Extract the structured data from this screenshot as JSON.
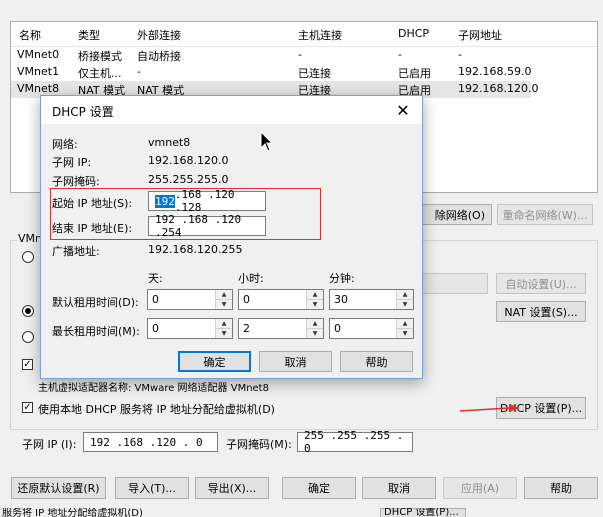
{
  "network_table": {
    "headers": [
      "名称",
      "类型",
      "外部连接",
      "主机连接",
      "DHCP",
      "子网地址"
    ],
    "rows": [
      [
        "VMnet0",
        "桥接模式",
        "自动桥接",
        "-",
        "-",
        "-"
      ],
      [
        "VMnet1",
        "仅主机...",
        "-",
        "已连接",
        "已启用",
        "192.168.59.0"
      ],
      [
        "VMnet8",
        "NAT 模式",
        "NAT 模式",
        "已连接",
        "已启用",
        "192.168.120.0"
      ]
    ]
  },
  "bg": {
    "remove_network": "除网络(O)",
    "rename_network": "重命名网络(W)...",
    "vmnet_group_fragment": "VMne",
    "auto_settings": "自动设置(U)...",
    "nat_settings": "NAT 设置(S)...",
    "host_adapter_name": "主机虚拟适配器名称: VMware 网络适配器 VMnet8",
    "dhcp_checkbox_label": "使用本地 DHCP 服务将 IP 地址分配给虚拟机(D)",
    "dhcp_settings": "DHCP 设置(P)...",
    "subnet_ip_label": "子网 IP (I):",
    "subnet_ip_value": "192 .168 .120 . 0",
    "subnet_mask_label": "子网掩码(M):",
    "subnet_mask_value": "255 .255 .255 . 0",
    "restore_defaults": "还原默认设置(R)",
    "import": "导入(T)...",
    "export": "导出(X)...",
    "ok": "确定",
    "cancel": "取消",
    "apply": "应用(A)",
    "help": "帮助",
    "status_left": "服务将 IP 地址分配给虚拟机(D)",
    "status_right": "DHCP 设置(P)..."
  },
  "dialog": {
    "title": "DHCP 设置",
    "network_label": "网络:",
    "network_value": "vmnet8",
    "subnet_ip_label": "子网 IP:",
    "subnet_ip_value": "192.168.120.0",
    "subnet_mask_label": "子网掩码:",
    "subnet_mask_value": "255.255.255.0",
    "start_ip_label": "起始 IP 地址(S):",
    "start_ip_sel": "192",
    "start_ip_rest": " .168 .120 .128",
    "end_ip_label": "结束 IP 地址(E):",
    "end_ip_value": "192 .168 .120 .254",
    "broadcast_label": "广播地址:",
    "broadcast_value": "192.168.120.255",
    "col_days": "天:",
    "col_hours": "小时:",
    "col_minutes": "分钟:",
    "default_lease_label": "默认租用时间(D):",
    "default_lease": [
      "0",
      "0",
      "30"
    ],
    "max_lease_label": "最长租用时间(M):",
    "max_lease": [
      "0",
      "2",
      "0"
    ],
    "ok": "确定",
    "cancel": "取消",
    "help": "帮助"
  },
  "colors": {
    "highlight_box": "#e03030",
    "arrow": "#e03030",
    "selection": "#0078d7"
  }
}
